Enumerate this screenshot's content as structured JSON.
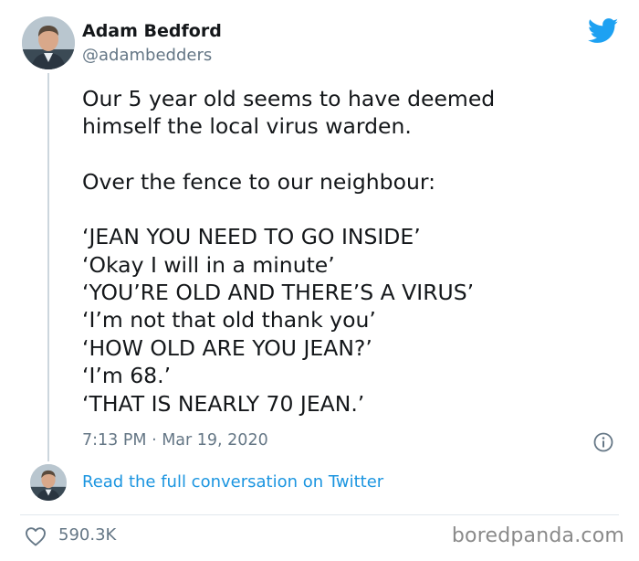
{
  "author": {
    "display_name": "Adam Bedford",
    "handle": "@adambedders"
  },
  "tweet": {
    "lines": [
      "Our 5 year old seems to have deemed",
      "himself the local virus warden.",
      "",
      "Over the fence to our neighbour:",
      "",
      "‘JEAN YOU NEED TO GO INSIDE’",
      "‘Okay I will in a minute’",
      "‘YOU’RE OLD AND THERE’S A VIRUS’",
      "‘I’m not that old thank you’",
      "‘HOW OLD ARE YOU JEAN?’",
      "‘I’m 68.’",
      "‘THAT IS NEARLY 70 JEAN.’"
    ],
    "timestamp": "7:13 PM · Mar 19, 2020"
  },
  "actions": {
    "read_conversation": "Read the full conversation on Twitter",
    "like_count": "590.3K"
  },
  "watermark": "boredpanda.com",
  "icons": {
    "brand": "twitter-bird-icon",
    "info": "info-icon",
    "like": "heart-icon"
  },
  "colors": {
    "twitter_blue": "#1da1f2",
    "link_blue": "#1b95e0",
    "secondary_text": "#657786",
    "divider": "#e1e8ed"
  }
}
